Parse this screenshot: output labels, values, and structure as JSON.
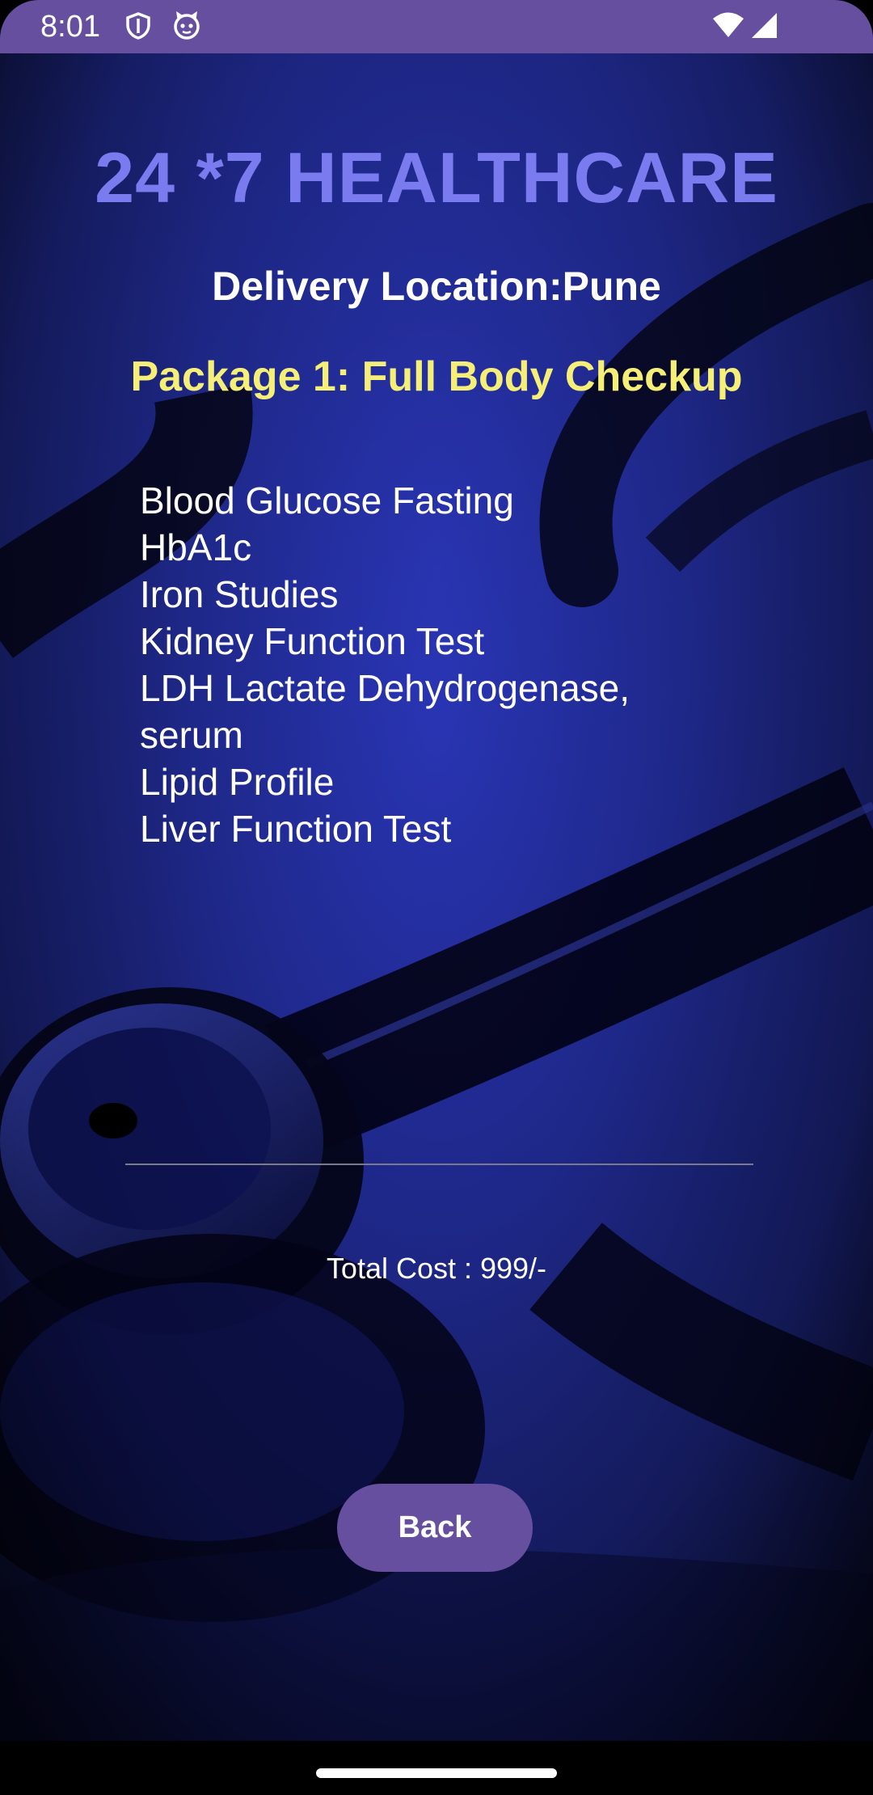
{
  "status_bar": {
    "time": "8:01",
    "background": "#674fa0",
    "left_icons": [
      "shield-icon",
      "cat-icon"
    ],
    "right_icons": [
      "wifi-icon",
      "signal-icon"
    ]
  },
  "header": {
    "title": "24 *7 HEALTHCARE",
    "title_color": "#7b7bf0"
  },
  "delivery": {
    "location_text": "Delivery Location:Pune"
  },
  "package": {
    "title": "Package 1: Full Body Checkup",
    "title_color": "#f5ef78",
    "tests": [
      "Blood Glucose Fasting",
      "HbA1c",
      "Iron Studies",
      "Kidney Function Test",
      "LDH Lactate Dehydrogenase,",
      "serum",
      "Lipid Profile",
      "Liver Function Test"
    ]
  },
  "summary": {
    "total_cost_text": "Total Cost : 999/-"
  },
  "actions": {
    "back_label": "Back",
    "button_color": "#674fa0"
  }
}
